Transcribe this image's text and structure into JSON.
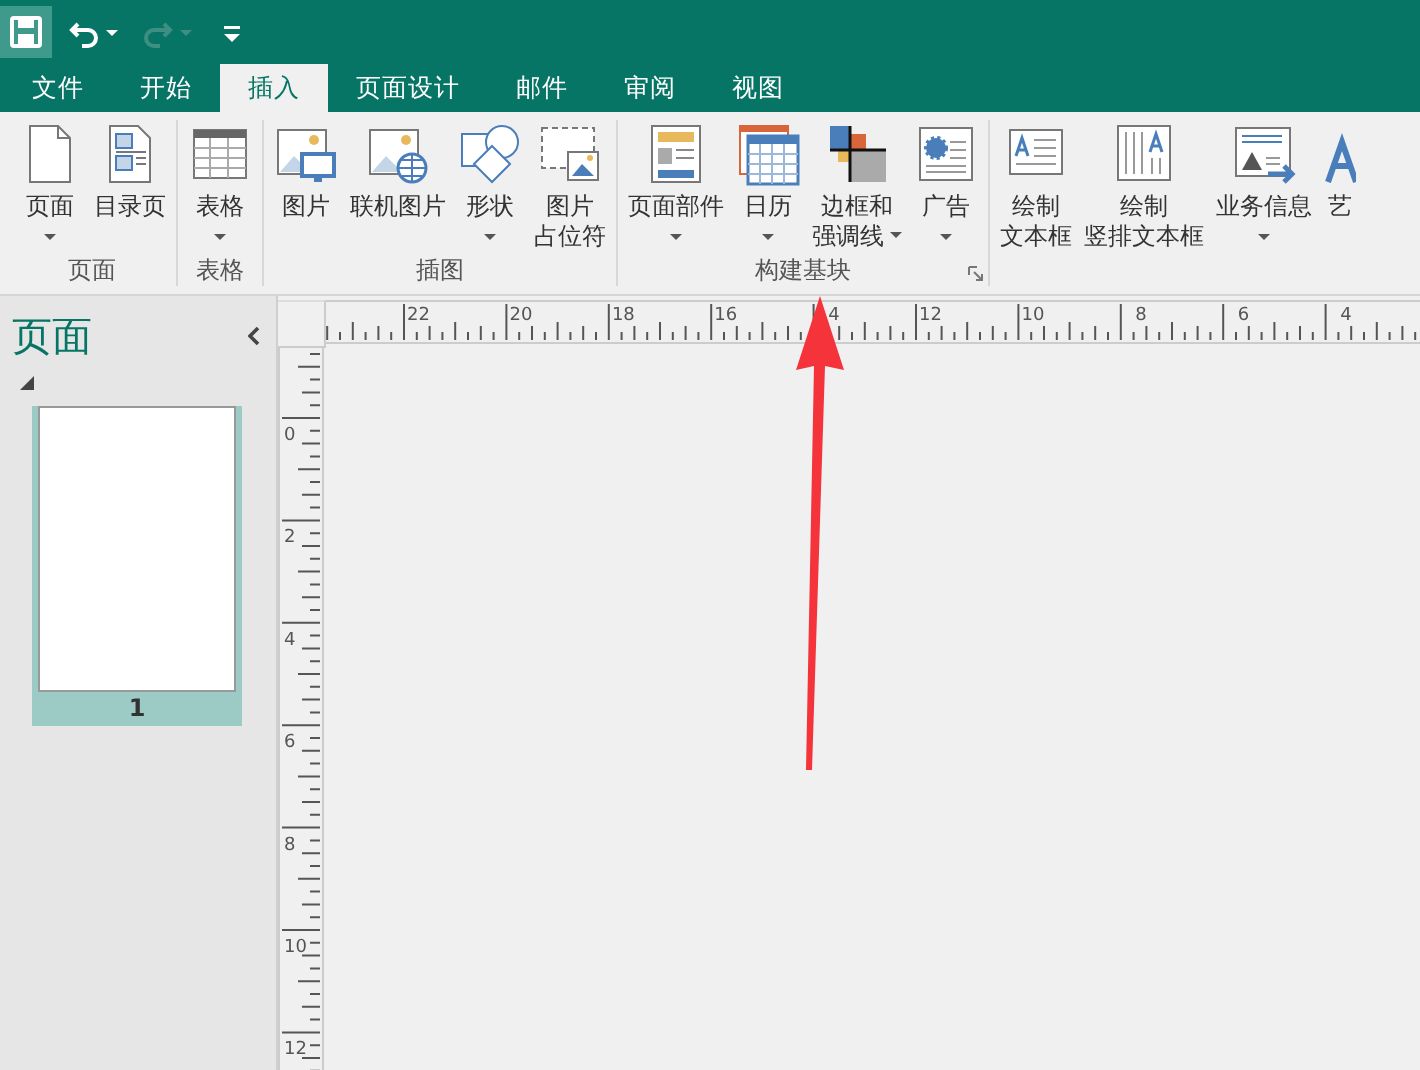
{
  "quick_access": [
    {
      "kind": "save",
      "disabled": false
    },
    {
      "kind": "undo",
      "disabled": false,
      "dropdown": true
    },
    {
      "kind": "redo",
      "disabled": true,
      "dropdown": true
    },
    {
      "kind": "customize",
      "disabled": false
    }
  ],
  "tabs": [
    {
      "label": "文件",
      "selected": false
    },
    {
      "label": "开始",
      "selected": false
    },
    {
      "label": "插入",
      "selected": true
    },
    {
      "label": "页面设计",
      "selected": false
    },
    {
      "label": "邮件",
      "selected": false
    },
    {
      "label": "审阅",
      "selected": false
    },
    {
      "label": "视图",
      "selected": false
    }
  ],
  "ribbon": {
    "groups": [
      {
        "label": "页面",
        "buttons": [
          {
            "lines": [
              "页面"
            ],
            "dropdown": true
          },
          {
            "lines": [
              "目录页"
            ]
          }
        ]
      },
      {
        "label": "表格",
        "buttons": [
          {
            "lines": [
              "表格"
            ],
            "dropdown": true
          }
        ]
      },
      {
        "label": "插图",
        "buttons": [
          {
            "lines": [
              "图片"
            ]
          },
          {
            "lines": [
              "联机图片"
            ]
          },
          {
            "lines": [
              "形状"
            ],
            "dropdown": true
          },
          {
            "lines": [
              "图片",
              "占位符"
            ]
          }
        ]
      },
      {
        "label": "构建基块",
        "launcher": true,
        "buttons": [
          {
            "lines": [
              "页面部件"
            ],
            "dropdown": true
          },
          {
            "lines": [
              "日历"
            ],
            "dropdown": true
          },
          {
            "lines": [
              "边框和",
              "强调线"
            ],
            "dropdown": true
          },
          {
            "lines": [
              "广告"
            ],
            "dropdown": true
          }
        ]
      },
      {
        "buttons": [
          {
            "lines": [
              "绘制",
              "文本框"
            ]
          },
          {
            "lines": [
              "绘制",
              "竖排文本框"
            ]
          },
          {
            "lines": [
              "业务信息"
            ],
            "dropdown": true
          },
          {
            "lines": [
              "艺"
            ]
          }
        ]
      }
    ]
  },
  "pages_pane": {
    "title": "页面",
    "pages": [
      {
        "number": "1",
        "selected": true
      }
    ]
  },
  "rulers": {
    "horizontal": [
      "22",
      "20",
      "18",
      "16",
      "4",
      "12",
      "10",
      "8",
      "6",
      "4"
    ],
    "vertical": [
      "0",
      "2",
      "4",
      "6",
      "8",
      "10",
      "12"
    ]
  }
}
